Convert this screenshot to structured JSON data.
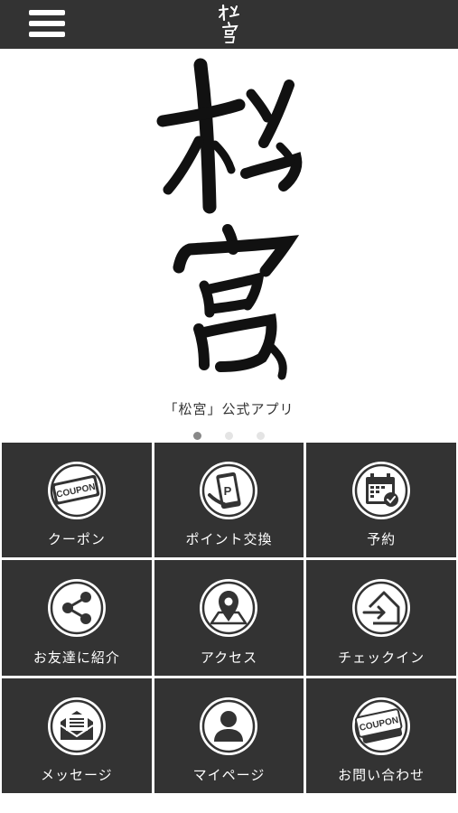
{
  "header": {
    "menu_icon": "hamburger-menu-icon",
    "logo_text": "松宮"
  },
  "hero": {
    "logo_text": "松宮",
    "caption": "「松宮」公式アプリ",
    "carousel_pages": 3,
    "carousel_active": 1
  },
  "menu": {
    "items": [
      {
        "label": "クーポン",
        "icon": "coupon-icon"
      },
      {
        "label": "ポイント交換",
        "icon": "point-exchange-icon"
      },
      {
        "label": "予約",
        "icon": "calendar-check-icon"
      },
      {
        "label": "お友達に紹介",
        "icon": "share-icon"
      },
      {
        "label": "アクセス",
        "icon": "map-pin-icon"
      },
      {
        "label": "チェックイン",
        "icon": "checkin-icon"
      },
      {
        "label": "メッセージ",
        "icon": "message-icon"
      },
      {
        "label": "マイページ",
        "icon": "user-icon"
      },
      {
        "label": "お問い合わせ",
        "icon": "contact-coupon-icon"
      }
    ],
    "coupon_text": "COUPON",
    "point_text": "P"
  },
  "colors": {
    "bar": "#333333",
    "tile": "#333333",
    "text_light": "#ffffff",
    "dot_active": "#888888",
    "dot_inactive": "#e4e4e4"
  }
}
